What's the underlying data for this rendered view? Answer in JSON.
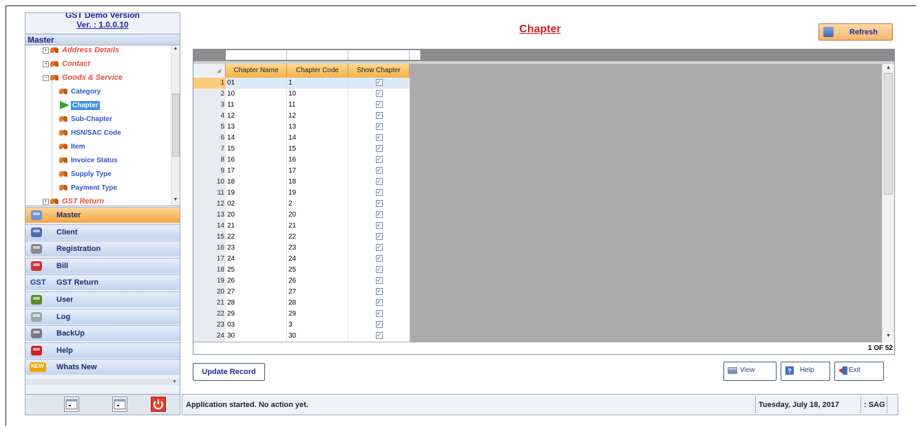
{
  "app": {
    "title_top": "GST Demo Version",
    "version": "Ver. : 1.0.0.10"
  },
  "tree": {
    "header": "Master",
    "collapse_glyph": "«",
    "items": [
      {
        "label": "Address Details",
        "level": 0,
        "kind": "group"
      },
      {
        "label": "Contact",
        "level": 0,
        "kind": "group"
      },
      {
        "label": "Goods & Service",
        "level": 0,
        "kind": "group-open"
      },
      {
        "label": "Category",
        "level": 1,
        "kind": "leaf"
      },
      {
        "label": "Chapter",
        "level": 1,
        "kind": "selected"
      },
      {
        "label": "Sub-Chapter",
        "level": 1,
        "kind": "leaf"
      },
      {
        "label": "HSN/SAC Code",
        "level": 1,
        "kind": "leaf"
      },
      {
        "label": "Item",
        "level": 1,
        "kind": "leaf"
      },
      {
        "label": "Invoice Status",
        "level": 1,
        "kind": "leaf"
      },
      {
        "label": "Supply Type",
        "level": 1,
        "kind": "leaf"
      },
      {
        "label": "Payment Type",
        "level": 1,
        "kind": "leaf"
      },
      {
        "label": "GST Return",
        "level": 0,
        "kind": "group"
      }
    ]
  },
  "nav": [
    {
      "label": "Master",
      "icon": "master-icon",
      "active": true
    },
    {
      "label": "Client",
      "icon": "client-icon"
    },
    {
      "label": "Registration",
      "icon": "registration-icon"
    },
    {
      "label": "Bill",
      "icon": "bill-icon"
    },
    {
      "label": "GST Return",
      "icon": "gst-icon",
      "icon_text": "GST"
    },
    {
      "label": "User",
      "icon": "user-icon"
    },
    {
      "label": "Log",
      "icon": "log-icon"
    },
    {
      "label": "BackUp",
      "icon": "backup-icon"
    },
    {
      "label": "Help",
      "icon": "help-icon"
    },
    {
      "label": "Whats New",
      "icon": "new-icon",
      "icon_text": "NEW"
    }
  ],
  "page": {
    "title": "Chapter",
    "refresh_label": "Refresh"
  },
  "grid": {
    "columns": [
      "Chapter Name",
      "Chapter Code",
      "Show Chapter"
    ],
    "rows": [
      [
        "1",
        "01",
        "1"
      ],
      [
        "2",
        "10",
        "10"
      ],
      [
        "3",
        "11",
        "11"
      ],
      [
        "4",
        "12",
        "12"
      ],
      [
        "5",
        "13",
        "13"
      ],
      [
        "6",
        "14",
        "14"
      ],
      [
        "7",
        "15",
        "15"
      ],
      [
        "8",
        "16",
        "16"
      ],
      [
        "9",
        "17",
        "17"
      ],
      [
        "10",
        "18",
        "18"
      ],
      [
        "11",
        "19",
        "19"
      ],
      [
        "12",
        "02",
        "2"
      ],
      [
        "13",
        "20",
        "20"
      ],
      [
        "14",
        "21",
        "21"
      ],
      [
        "15",
        "22",
        "22"
      ],
      [
        "16",
        "23",
        "23"
      ],
      [
        "17",
        "24",
        "24"
      ],
      [
        "18",
        "25",
        "25"
      ],
      [
        "19",
        "26",
        "26"
      ],
      [
        "20",
        "27",
        "27"
      ],
      [
        "21",
        "28",
        "28"
      ],
      [
        "22",
        "29",
        "29"
      ],
      [
        "23",
        "03",
        "3"
      ],
      [
        "24",
        "30",
        "30"
      ]
    ],
    "show_checked": true,
    "paging": "1 OF 52"
  },
  "buttons": {
    "update": "Update Record",
    "view": "View",
    "help": "Help",
    "exit": "Exit"
  },
  "status": {
    "message": "Application started. No action yet.",
    "date": "Tuesday, July 18, 2017",
    "user": ": SAG"
  }
}
